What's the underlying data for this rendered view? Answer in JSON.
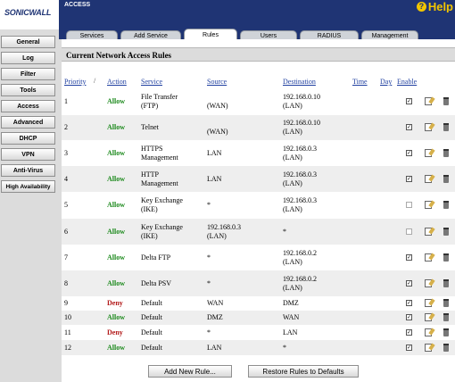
{
  "brand": {
    "logo_text": "SONICWALL"
  },
  "header": {
    "section": "ACCESS",
    "help_label": "Help",
    "help_icon": "question-circle-icon"
  },
  "sidebar": {
    "items": [
      {
        "label": "General"
      },
      {
        "label": "Log"
      },
      {
        "label": "Filter"
      },
      {
        "label": "Tools"
      },
      {
        "label": "Access"
      },
      {
        "label": "Advanced"
      },
      {
        "label": "DHCP"
      },
      {
        "label": "VPN"
      },
      {
        "label": "Anti-Virus"
      },
      {
        "label": "High Availability"
      }
    ]
  },
  "tabs": [
    {
      "label": "Services"
    },
    {
      "label": "Add Service"
    },
    {
      "label": "Rules",
      "active": true
    },
    {
      "label": "Users"
    },
    {
      "label": "RADIUS"
    },
    {
      "label": "Management"
    }
  ],
  "main": {
    "title": "Current Network Access Rules",
    "columns": {
      "priority": "Priority",
      "action": "Action",
      "service": "Service",
      "source": "Source",
      "destination": "Destination",
      "time": "Time",
      "day": "Day",
      "enable": "Enable"
    },
    "rules": [
      {
        "priority": "1",
        "action": "Allow",
        "service": [
          "File Transfer",
          "(FTP)"
        ],
        "source": [
          "",
          "(WAN)"
        ],
        "destination": [
          "192.168.0.10",
          "(LAN)"
        ],
        "enabled": true
      },
      {
        "priority": "2",
        "action": "Allow",
        "service": [
          "Telnet"
        ],
        "source": [
          "",
          "(WAN)"
        ],
        "destination": [
          "192.168.0.10",
          "(LAN)"
        ],
        "enabled": true
      },
      {
        "priority": "3",
        "action": "Allow",
        "service": [
          "HTTPS",
          "Management"
        ],
        "source": [
          "LAN"
        ],
        "destination": [
          "192.168.0.3",
          "(LAN)"
        ],
        "enabled": true
      },
      {
        "priority": "4",
        "action": "Allow",
        "service": [
          "HTTP",
          "Management"
        ],
        "source": [
          "LAN"
        ],
        "destination": [
          "192.168.0.3",
          "(LAN)"
        ],
        "enabled": true
      },
      {
        "priority": "5",
        "action": "Allow",
        "service": [
          "Key Exchange",
          "(IKE)"
        ],
        "source": [
          "*"
        ],
        "destination": [
          "192.168.0.3",
          "(LAN)"
        ],
        "enabled": false
      },
      {
        "priority": "6",
        "action": "Allow",
        "service": [
          "Key Exchange",
          "(IKE)"
        ],
        "source": [
          "192.168.0.3",
          "(LAN)"
        ],
        "destination": [
          "*"
        ],
        "enabled": false
      },
      {
        "priority": "7",
        "action": "Allow",
        "service": [
          "Delta FTP"
        ],
        "source": [
          "*"
        ],
        "destination": [
          "192.168.0.2",
          "(LAN)"
        ],
        "enabled": true
      },
      {
        "priority": "8",
        "action": "Allow",
        "service": [
          "Delta PSV"
        ],
        "source": [
          "*"
        ],
        "destination": [
          "192.168.0.2",
          "(LAN)"
        ],
        "enabled": true
      },
      {
        "priority": "9",
        "action": "Deny",
        "service": [
          "Default"
        ],
        "source": [
          "WAN"
        ],
        "destination": [
          "DMZ"
        ],
        "enabled": true
      },
      {
        "priority": "10",
        "action": "Allow",
        "service": [
          "Default"
        ],
        "source": [
          "DMZ"
        ],
        "destination": [
          "WAN"
        ],
        "enabled": true
      },
      {
        "priority": "11",
        "action": "Deny",
        "service": [
          "Default"
        ],
        "source": [
          "*"
        ],
        "destination": [
          "LAN"
        ],
        "enabled": true
      },
      {
        "priority": "12",
        "action": "Allow",
        "service": [
          "Default"
        ],
        "source": [
          "LAN"
        ],
        "destination": [
          "*"
        ],
        "enabled": true
      }
    ],
    "buttons": {
      "add_rule": "Add New Rule...",
      "restore": "Restore Rules to Defaults"
    }
  },
  "colors": {
    "banner": "#1f3474",
    "allow": "#1d8a1d",
    "deny": "#b31b1b",
    "link": "#1f3fa0",
    "help": "#f2c500"
  }
}
